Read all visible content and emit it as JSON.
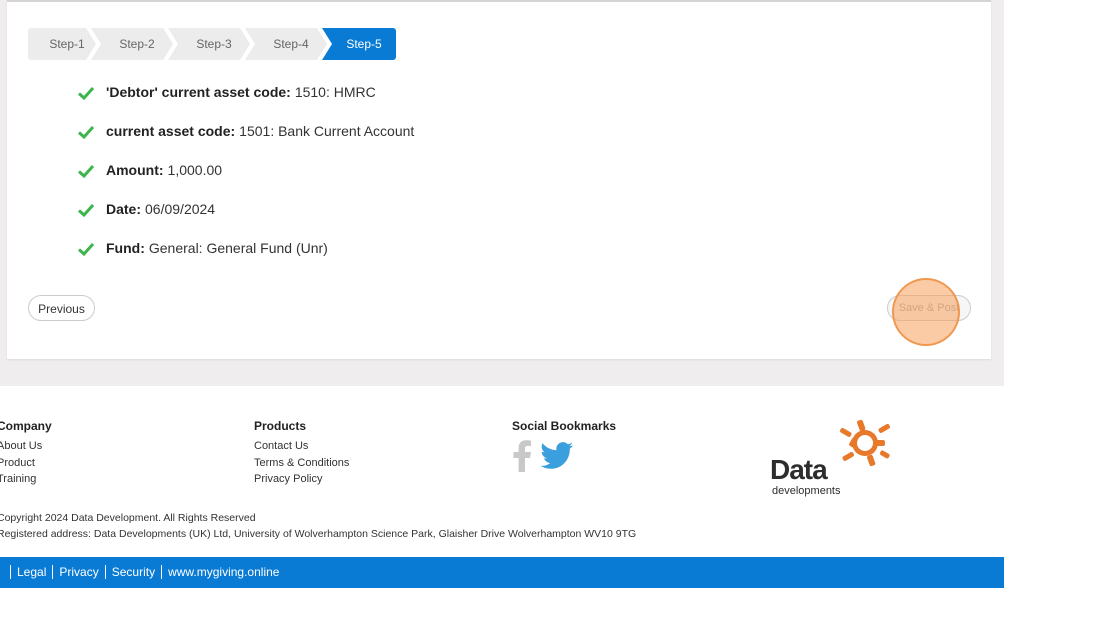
{
  "wizard": {
    "steps": [
      "Step-1",
      "Step-2",
      "Step-3",
      "Step-4",
      "Step-5"
    ],
    "active_step": "Step-5"
  },
  "summary": [
    {
      "label": "'Debtor' current asset code:",
      "value": "1510: HMRC"
    },
    {
      "label": "current asset code:",
      "value": "1501: Bank Current Account"
    },
    {
      "label": "Amount:",
      "value": "1,000.00"
    },
    {
      "label": "Date:",
      "value": "06/09/2024"
    },
    {
      "label": "Fund:",
      "value": "General: General Fund (Unr)"
    }
  ],
  "buttons": {
    "previous": "Previous",
    "save_post": "Save & Post"
  },
  "footer": {
    "company": {
      "title": "Company",
      "links": [
        "About Us",
        "Product",
        "Training"
      ]
    },
    "products": {
      "title": "Products",
      "links": [
        "Contact Us",
        "Terms & Conditions",
        "Privacy Policy"
      ]
    },
    "social": {
      "title": "Social Bookmarks",
      "icons": [
        "facebook-icon",
        "twitter-icon"
      ]
    },
    "logo": {
      "word1": "Data",
      "word2": "developments"
    },
    "copyright": "Copyright 2024 Data Development. All Rights Reserved",
    "address": "Registered address: Data Developments (UK) Ltd, University of Wolverhampton Science Park, Glaisher Drive Wolverhampton WV10 9TG"
  },
  "bottom_links": [
    "Legal",
    "Privacy",
    "Security",
    "www.mygiving.online"
  ],
  "colors": {
    "accent": "#0a7bd4",
    "check": "#3cb54a",
    "logo_orange": "#e8782a"
  }
}
